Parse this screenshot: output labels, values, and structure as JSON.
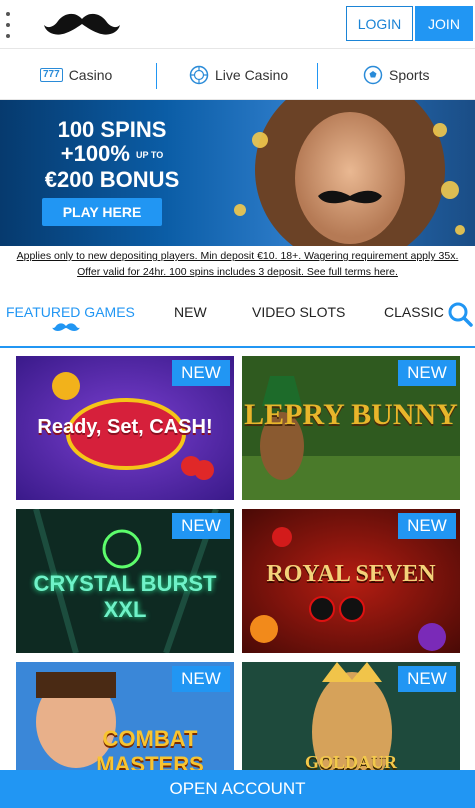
{
  "header": {
    "login_label": "LOGIN",
    "join_label": "JOIN"
  },
  "categories": [
    {
      "label": "Casino",
      "icon": "slot-777-icon"
    },
    {
      "label": "Live Casino",
      "icon": "chip-icon"
    },
    {
      "label": "Sports",
      "icon": "soccer-ball-icon"
    }
  ],
  "banner": {
    "line1": "100 SPINS",
    "line2a": "+100%",
    "line2b": "UP TO",
    "line3": "€200 BONUS",
    "button": "PLAY HERE"
  },
  "terms": {
    "line1": "Applies only to new depositing players. Min deposit €10. 18+. Wagering requirement apply 35x.",
    "line2": "Offer valid for 24hr. 100 spins includes 3 deposit. See full terms here."
  },
  "tabs": [
    {
      "label": "FEATURED GAMES",
      "active": true
    },
    {
      "label": "NEW"
    },
    {
      "label": "VIDEO SLOTS"
    },
    {
      "label": "CLASSIC"
    }
  ],
  "games": [
    {
      "title": "Ready, Set, CASH!",
      "badge": "NEW"
    },
    {
      "title": "LEPRY BUNNY",
      "badge": "NEW"
    },
    {
      "title": "CRYSTAL BURST XXL",
      "badge": "NEW"
    },
    {
      "title": "ROYAL SEVEN",
      "badge": "NEW"
    },
    {
      "title": "COMBAT MASTERS",
      "badge": "NEW"
    },
    {
      "title": "GOLDAUR",
      "badge": "NEW"
    }
  ],
  "footer": {
    "open_account": "OPEN ACCOUNT"
  },
  "colors": {
    "accent": "#2196f3"
  }
}
